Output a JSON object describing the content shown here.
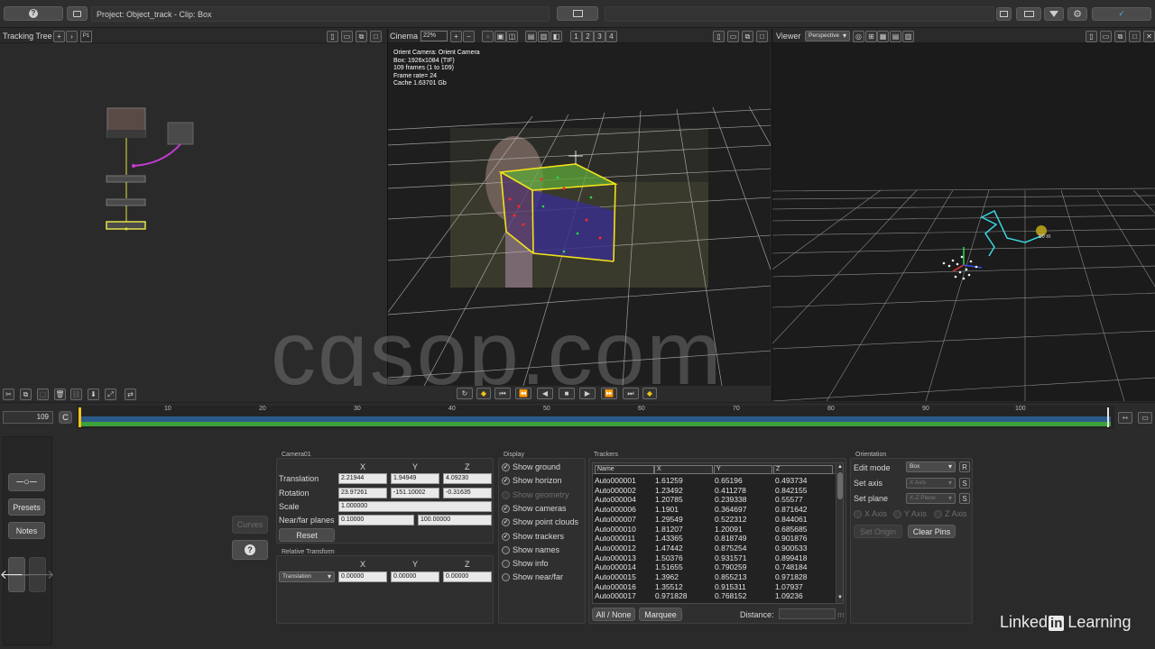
{
  "top_bar": {
    "project_clip": "Project: Object_track - Clip: Box"
  },
  "tracking_tree": {
    "title": "Tracking Tree",
    "tab": "P1"
  },
  "cinema": {
    "title": "Cinema",
    "zoom": "22%",
    "layers": [
      "1",
      "2",
      "3",
      "4"
    ],
    "info": [
      "Orient Camera: Orient Camera",
      "Box: 1926x1084 (TIF)",
      "109 frames (1 to 109)",
      "Frame rate= 24",
      "Cache 1.63701 Gb"
    ]
  },
  "viewer": {
    "title": "Viewer",
    "mode": "Perspective",
    "distance_label": "10 m"
  },
  "watermark": "cgsop.com",
  "timeline": {
    "frame": "109",
    "c_button": "C",
    "ticks": [
      "10",
      "20",
      "30",
      "40",
      "50",
      "60",
      "70",
      "80",
      "90",
      "100"
    ]
  },
  "left_tools": {
    "presets": "Presets",
    "notes": "Notes",
    "curves": "Curves",
    "help": "?"
  },
  "camera": {
    "title": "Camera01",
    "headers": [
      "X",
      "Y",
      "Z"
    ],
    "translation_label": "Translation",
    "translation": [
      "2.21944",
      "1.94949",
      "4.09230"
    ],
    "rotation_label": "Rotation",
    "rotation": [
      "23.97261",
      "-151.10002",
      "-0.31635"
    ],
    "scale_label": "Scale",
    "scale": "1.000000",
    "near_far_label": "Near/far planes",
    "near": "0.10000",
    "far": "100.00000",
    "reset": "Reset"
  },
  "relative": {
    "title": "Relative Transform",
    "headers": [
      "X",
      "Y",
      "Z"
    ],
    "mode": "Translation",
    "values": [
      "0.00000",
      "0.00000",
      "0.00000"
    ]
  },
  "display": {
    "title": "Display",
    "items": [
      {
        "label": "Show ground",
        "checked": true,
        "enabled": true
      },
      {
        "label": "Show horizon",
        "checked": true,
        "enabled": true
      },
      {
        "label": "Show geometry",
        "checked": false,
        "enabled": false
      },
      {
        "label": "Show cameras",
        "checked": true,
        "enabled": true
      },
      {
        "label": "Show point clouds",
        "checked": true,
        "enabled": true
      },
      {
        "label": "Show trackers",
        "checked": true,
        "enabled": true
      },
      {
        "label": "Show names",
        "checked": false,
        "enabled": true
      },
      {
        "label": "Show info",
        "checked": false,
        "enabled": true
      },
      {
        "label": "Show near/far",
        "checked": false,
        "enabled": true
      }
    ]
  },
  "trackers": {
    "title": "Trackers",
    "columns": [
      "Name",
      "X",
      "Y",
      "Z"
    ],
    "rows": [
      [
        "Auto000001",
        "1.61259",
        "0.65196",
        "0.493734"
      ],
      [
        "Auto000002",
        "1.23492",
        "0.411278",
        "0.842155"
      ],
      [
        "Auto000004",
        "1.20785",
        "0.239338",
        "0.55577"
      ],
      [
        "Auto000006",
        "1.1901",
        "0.364697",
        "0.871642"
      ],
      [
        "Auto000007",
        "1.29549",
        "0.522312",
        "0.844061"
      ],
      [
        "Auto000010",
        "1.81207",
        "1.20091",
        "0.685685"
      ],
      [
        "Auto000011",
        "1.43365",
        "0.818749",
        "0.901876"
      ],
      [
        "Auto000012",
        "1.47442",
        "0.875254",
        "0.900533"
      ],
      [
        "Auto000013",
        "1.50376",
        "0.931571",
        "0.899418"
      ],
      [
        "Auto000014",
        "1.51655",
        "0.790259",
        "0.748184"
      ],
      [
        "Auto000015",
        "1.3962",
        "0.855213",
        "0.971828"
      ],
      [
        "Auto000016",
        "1.35512",
        "0.915311",
        "1.07937"
      ],
      [
        "Auto000017",
        "0.971828",
        "0.768152",
        "1.09236"
      ]
    ],
    "all_none": "All / None",
    "marquee": "Marquee",
    "distance_label": "Distance:",
    "distance_unit": "m"
  },
  "orientation": {
    "title": "Orientation",
    "edit_mode_label": "Edit mode",
    "edit_mode": "Box",
    "set_axis_label": "Set axis",
    "set_axis": "X Axis",
    "set_plane_label": "Set plane",
    "set_plane": "X-Z Plane",
    "s": "S",
    "r": "R",
    "axes": [
      "X Axis",
      "Y Axis",
      "Z Axis"
    ],
    "set_origin": "Set Origin",
    "clear_pins": "Clear Pins"
  },
  "branding": {
    "brand": "Linked",
    "in": "in",
    "learning": "Learning"
  }
}
